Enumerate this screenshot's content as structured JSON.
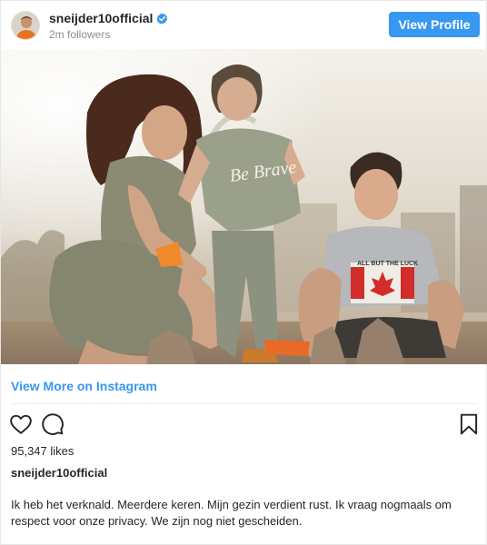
{
  "header": {
    "username": "sneijder10official",
    "followers": "2m followers",
    "view_profile_label": "View Profile"
  },
  "post": {
    "view_more_label": "View More on Instagram",
    "likes": "95,347 likes",
    "caption_username": "sneijder10official",
    "caption_text": "Ik heb het verknald. Meerdere keren. Mijn gezin verdient rust. Ik vraag nogmaals om respect voor onze privacy. We zijn nog niet gescheiden.",
    "shirt_text_toddler": "Be Brave",
    "shirt_text_boy": "ALL BUT THE LUCK"
  },
  "colors": {
    "accent": "#3897f0",
    "text": "#262626",
    "muted": "#8e8e8e"
  },
  "icons": {
    "verified": "verified-badge-icon",
    "like": "heart-icon",
    "comment": "comment-icon",
    "save": "bookmark-icon"
  }
}
